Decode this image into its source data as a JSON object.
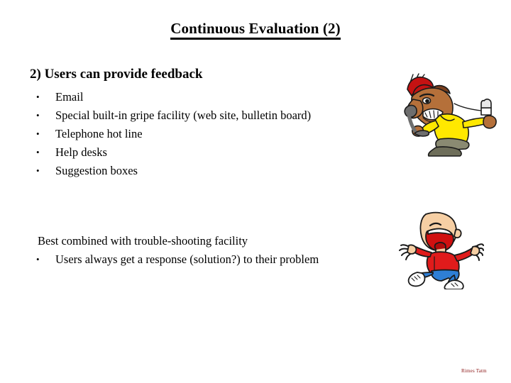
{
  "slide": {
    "title": "Continuous Evaluation (2)",
    "heading": "2) Users can provide feedback",
    "bullet_char": "•",
    "bullets": [
      {
        "label": "Email"
      },
      {
        "label": "Special built-in gripe facility (web site, bulletin board)"
      },
      {
        "label": "Telephone hot line"
      },
      {
        "label": "Help desks"
      },
      {
        "label": "Suggestion boxes"
      }
    ],
    "lower": {
      "lead": "Best combined with trouble-shooting facility",
      "bullet": "Users always get a response (solution?) to their problem"
    },
    "footer_credit": "Rimes Tatm",
    "background_color": "#ffffff",
    "text_color": "#000000",
    "footer_color": "#8a1414"
  },
  "clipart": {
    "angry_phone": {
      "name": "angry-man-shouting-into-telephone",
      "colors": {
        "hair": "#c41212",
        "skin": "#b5703a",
        "shirt": "#ffe800",
        "pants": "#8a8a72",
        "phone": "#6e6e6e",
        "outline": "#1a1a1a"
      }
    },
    "happy_jump": {
      "name": "laughing-jumping-man",
      "colors": {
        "skin": "#f6cfa4",
        "shirt": "#e01b1b",
        "pants": "#2e7fd6",
        "shoes": "#ffffff",
        "mouth": "#d01010",
        "outline": "#1a1a1a"
      }
    }
  }
}
